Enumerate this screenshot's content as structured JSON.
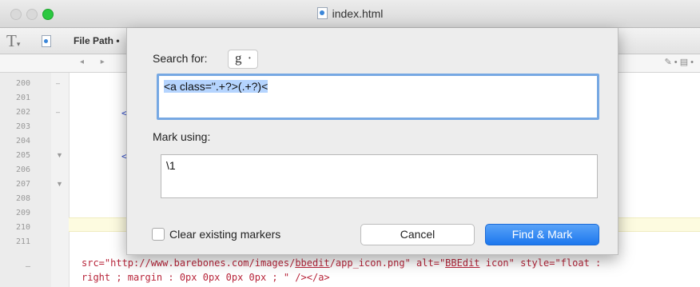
{
  "window": {
    "title": "index.html"
  },
  "toolbar": {
    "text_tool_glyph": "T",
    "file_path_label": "File Path •"
  },
  "nav": {
    "arrows": "◂ ▸",
    "right_tools": "✎ • ▤ •"
  },
  "gutter": {
    "lines": [
      "200",
      "201",
      "202",
      "203",
      "204",
      "205",
      "206",
      "207",
      "208",
      "209",
      "210",
      "211"
    ],
    "fold_marks": [
      "–",
      "",
      "–",
      "",
      "",
      "▼",
      "",
      "▼",
      "",
      "",
      "",
      ""
    ],
    "continuation_mark": "–"
  },
  "editor": {
    "brackets": [
      "<",
      "<"
    ],
    "code_line1_pre": "src=\"http://www.barebones.com/images/",
    "code_line1_ul": "bbedit",
    "code_line1_mid": "/app_icon.png\" alt=\"",
    "code_line1_ul2": "BBEdit",
    "code_line1_post": " icon\" style=\"float :",
    "code_line2": "right ; margin : 0px 0px 0px 0px ; \" /></a>"
  },
  "dialog": {
    "search_label": "Search for:",
    "grep_glyph": "g",
    "grep_caret": "•",
    "search_value": "<a class=\".+?>(.+?)<",
    "mark_label": "Mark using:",
    "mark_value": "\\1",
    "clear_markers_label": "Clear existing markers",
    "clear_markers_checked": false,
    "cancel_label": "Cancel",
    "find_mark_label": "Find & Mark"
  },
  "colors": {
    "accent": "#1c77ee",
    "selection": "#b5d4fe",
    "focus_ring": "#76a8e3"
  }
}
